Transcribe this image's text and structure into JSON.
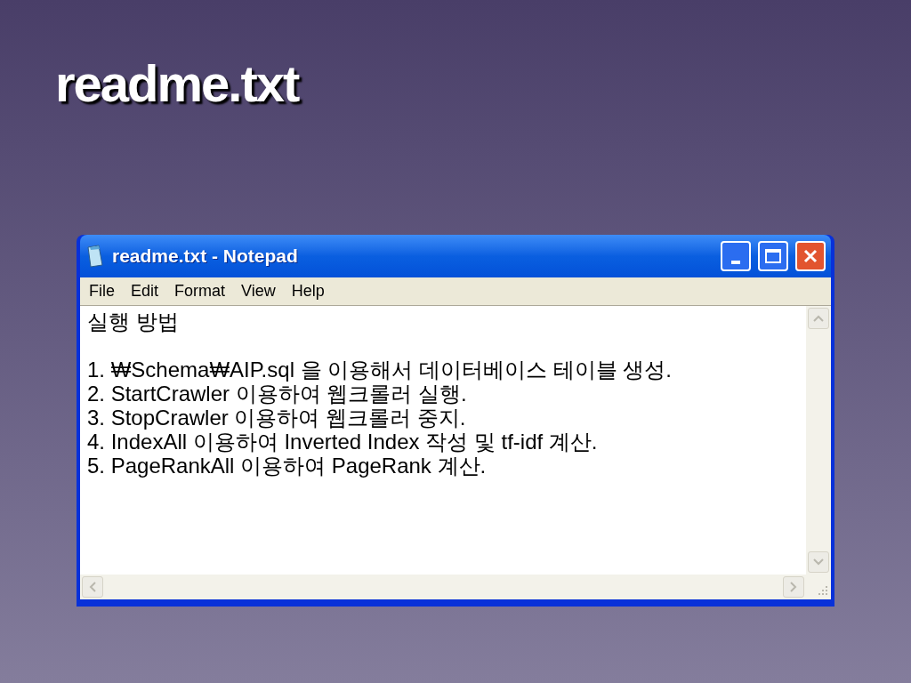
{
  "slide": {
    "title": "readme.txt"
  },
  "window": {
    "title": "readme.txt - Notepad"
  },
  "menu": [
    "File",
    "Edit",
    "Format",
    "View",
    "Help"
  ],
  "editor": {
    "heading": "실행 방법",
    "lines": [
      "1. ₩Schema₩AIP.sql 을 이용해서 데이터베이스 테이블 생성.",
      "2. StartCrawler 이용하여 웹크롤러 실행.",
      "3. StopCrawler 이용하여 웹크롤러 중지.",
      "4. IndexAll 이용하여 Inverted Index 작성 및 tf-idf 계산.",
      "5. PageRankAll 이용하여 PageRank 계산."
    ]
  }
}
